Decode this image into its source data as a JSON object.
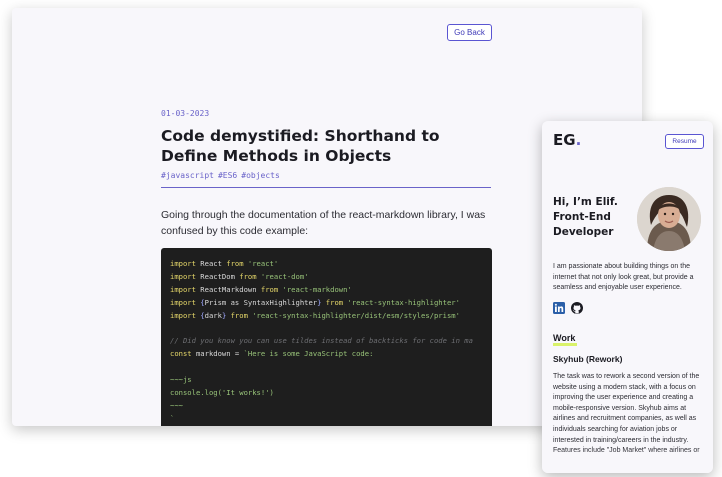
{
  "desktop": {
    "go_back_label": "Go Back",
    "post": {
      "date": "01-03-2023",
      "title": "Code demystified: Shorthand to Define Methods in Objects",
      "tags": [
        "#javascript",
        "#ES6",
        "#objects"
      ],
      "intro": "Going through the documentation of the react-markdown library, I was confused by this code example:",
      "code_lines": [
        [
          {
            "t": "kw",
            "v": "import"
          },
          {
            "t": "",
            "v": " React "
          },
          {
            "t": "kw",
            "v": "from"
          },
          {
            "t": "",
            "v": " "
          },
          {
            "t": "str",
            "v": "'react'"
          }
        ],
        [
          {
            "t": "kw",
            "v": "import"
          },
          {
            "t": "",
            "v": " ReactDom "
          },
          {
            "t": "kw",
            "v": "from"
          },
          {
            "t": "",
            "v": " "
          },
          {
            "t": "str",
            "v": "'react-dom'"
          }
        ],
        [
          {
            "t": "kw",
            "v": "import"
          },
          {
            "t": "",
            "v": " ReactMarkdown "
          },
          {
            "t": "kw",
            "v": "from"
          },
          {
            "t": "",
            "v": " "
          },
          {
            "t": "str",
            "v": "'react-markdown'"
          }
        ],
        [
          {
            "t": "kw",
            "v": "import"
          },
          {
            "t": "",
            "v": " "
          },
          {
            "t": "br",
            "v": "{"
          },
          {
            "t": "",
            "v": "Prism as SyntaxHighlighter"
          },
          {
            "t": "br",
            "v": "}"
          },
          {
            "t": "",
            "v": " "
          },
          {
            "t": "kw",
            "v": "from"
          },
          {
            "t": "",
            "v": " "
          },
          {
            "t": "str",
            "v": "'react-syntax-highlighter'"
          }
        ],
        [
          {
            "t": "kw",
            "v": "import"
          },
          {
            "t": "",
            "v": " "
          },
          {
            "t": "br",
            "v": "{"
          },
          {
            "t": "",
            "v": "dark"
          },
          {
            "t": "br",
            "v": "}"
          },
          {
            "t": "",
            "v": " "
          },
          {
            "t": "kw",
            "v": "from"
          },
          {
            "t": "",
            "v": " "
          },
          {
            "t": "str",
            "v": "'react-syntax-highlighter/dist/esm/styles/prism'"
          }
        ],
        [],
        [
          {
            "t": "cm",
            "v": "// Did you know you can use tildes instead of backticks for code in ma"
          }
        ],
        [
          {
            "t": "kw",
            "v": "const"
          },
          {
            "t": "",
            "v": " markdown = "
          },
          {
            "t": "str",
            "v": "`Here is some JavaScript code:"
          }
        ],
        [],
        [
          {
            "t": "str",
            "v": "~~~js"
          }
        ],
        [
          {
            "t": "str",
            "v": "console.log('It works!')"
          }
        ],
        [
          {
            "t": "str",
            "v": "~~~"
          }
        ],
        [
          {
            "t": "str",
            "v": "`"
          }
        ]
      ]
    }
  },
  "mobile": {
    "logo": "EG",
    "logo_dot": ".",
    "resume_label": "Resume",
    "hero_heading": "Hi, I’m Elif. Front-End Developer",
    "bio": "I am passionate about building things on the internet that not only look great, but provide a seamless and enjoyable user experience.",
    "social_icons": [
      "linkedin-icon",
      "github-icon"
    ],
    "work_label": "Work",
    "project": {
      "title": "Skyhub (Rework)",
      "description": "The task was to rework a second version of the website using a modern stack, with a focus on improving the user experience and creating a mobile-responsive version. Skyhub aims at airlines and recruitment companies, as well as individuals searching for aviation jobs or interested in training/careers in the industry. Features include \"Job Market\" where airlines or"
    }
  },
  "colors": {
    "accent": "#6a63c9",
    "highlight": "#d9f26a",
    "code_bg": "#1e1e1e"
  }
}
